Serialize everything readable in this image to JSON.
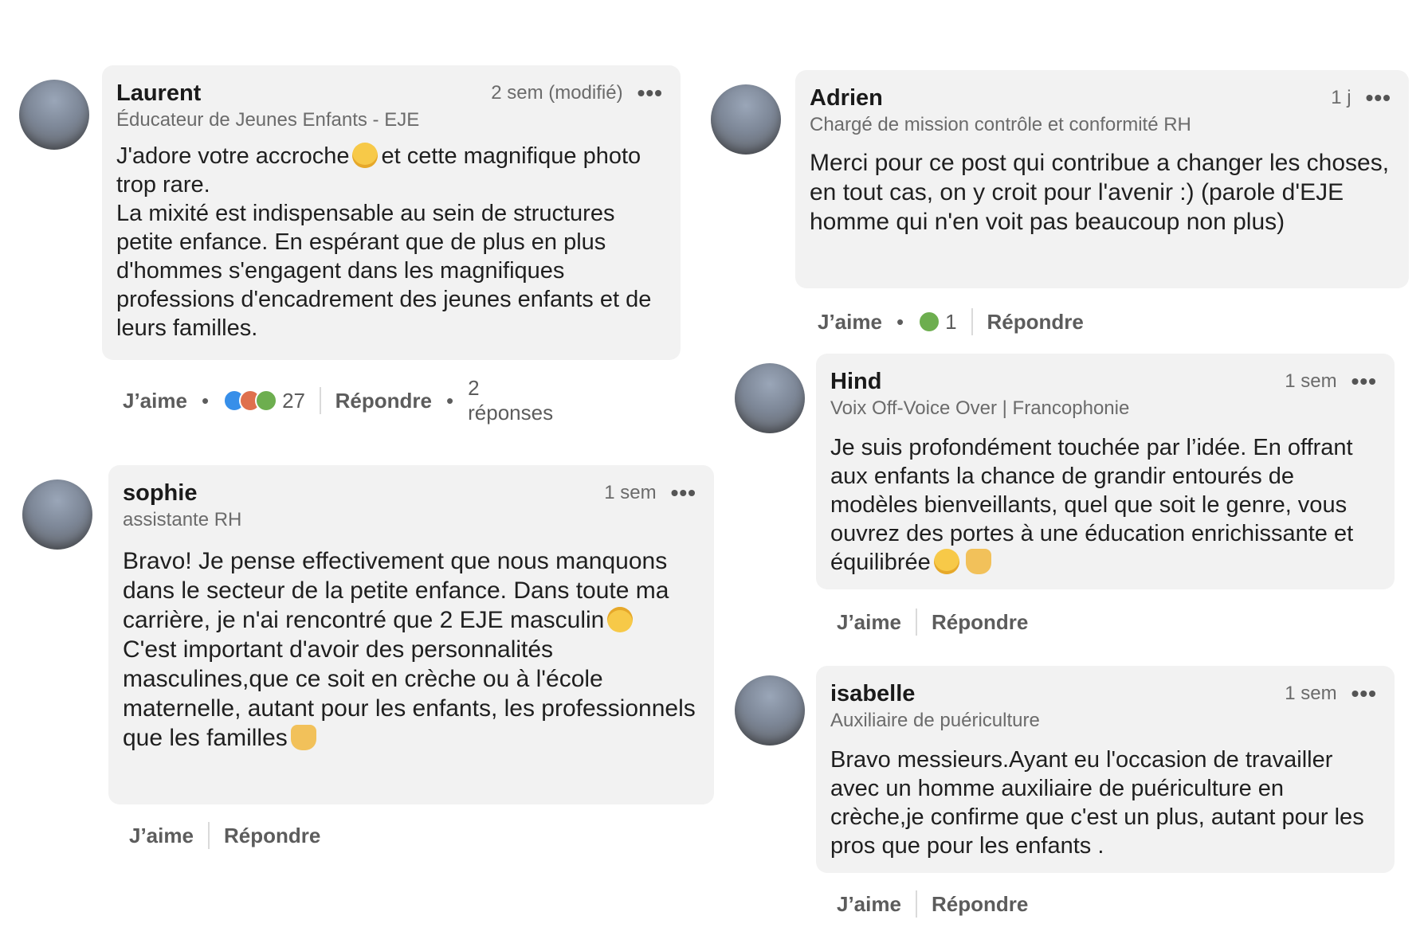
{
  "comments": {
    "laurent": {
      "name": "Laurent",
      "headline": "Éducateur de Jeunes Enfants - EJE",
      "time": "2 sem (modifié)",
      "text_a": "J'adore votre accroche",
      "text_b": "et cette magnifique photo trop rare.",
      "text_c": "La mixité est indispensable au sein de structures petite enfance. En espérant que de plus en plus d'hommes s'engagent dans les magnifiques professions d'encadrement des jeunes enfants et de leurs familles.",
      "like": "J’aime",
      "reaction_count": "27",
      "reply": "Répondre",
      "replies": "2 réponses"
    },
    "sophie": {
      "name": "sophie",
      "headline": "assistante RH",
      "time": "1 sem",
      "text_a": "Bravo! Je pense effectivement que nous manquons dans le secteur de la petite enfance. Dans toute ma carrière, je n'ai rencontré que 2 EJE masculin",
      "text_b": "C'est important d'avoir des personnalités masculines,que ce soit en crèche ou à  l'école maternelle, autant pour les enfants, les professionnels que les familles",
      "like": "J’aime",
      "reply": "Répondre"
    },
    "adrien": {
      "name": "Adrien",
      "headline": "Chargé de mission contrôle et conformité RH",
      "time": "1 j",
      "text": "Merci pour ce post qui contribue a changer les choses, en tout cas, on y croit pour l'avenir :) (parole d'EJE homme qui n'en voit pas beaucoup non plus)",
      "like": "J’aime",
      "reaction_count": "1",
      "reply": "Répondre"
    },
    "hind": {
      "name": "Hind",
      "headline": "Voix Off-Voice Over | Francophonie",
      "time": "1 sem",
      "text": "Je suis profondément touchée par l’idée. En offrant aux enfants la chance de grandir entourés de modèles bienveillants, quel que soit le genre, vous ouvrez des portes à une éducation enrichissante et équilibrée",
      "like": "J’aime",
      "reply": "Répondre"
    },
    "isabelle": {
      "name": "isabelle",
      "headline": "Auxiliaire de puériculture",
      "time": "1 sem",
      "text": "Bravo messieurs.Ayant eu l'occasion de travailler avec un homme auxiliaire de puériculture en crèche,je confirme que c'est un plus, autant pour les pros que pour les enfants .",
      "like": "J’aime",
      "reply": "Répondre"
    }
  },
  "icons": {
    "more": "more-options-icon",
    "reactions": [
      "like-reaction-icon",
      "love-reaction-icon",
      "celebrate-reaction-icon"
    ],
    "emoji": [
      "grinning-face-icon",
      "upside-down-face-icon",
      "smiling-face-icon",
      "raising-hands-icon",
      "clapping-hands-icon"
    ]
  },
  "colors": {
    "bubble": "#f2f2f2",
    "like_reaction": "#378fe9",
    "love_reaction": "#df704d",
    "celebrate_reaction": "#6dae4f"
  }
}
